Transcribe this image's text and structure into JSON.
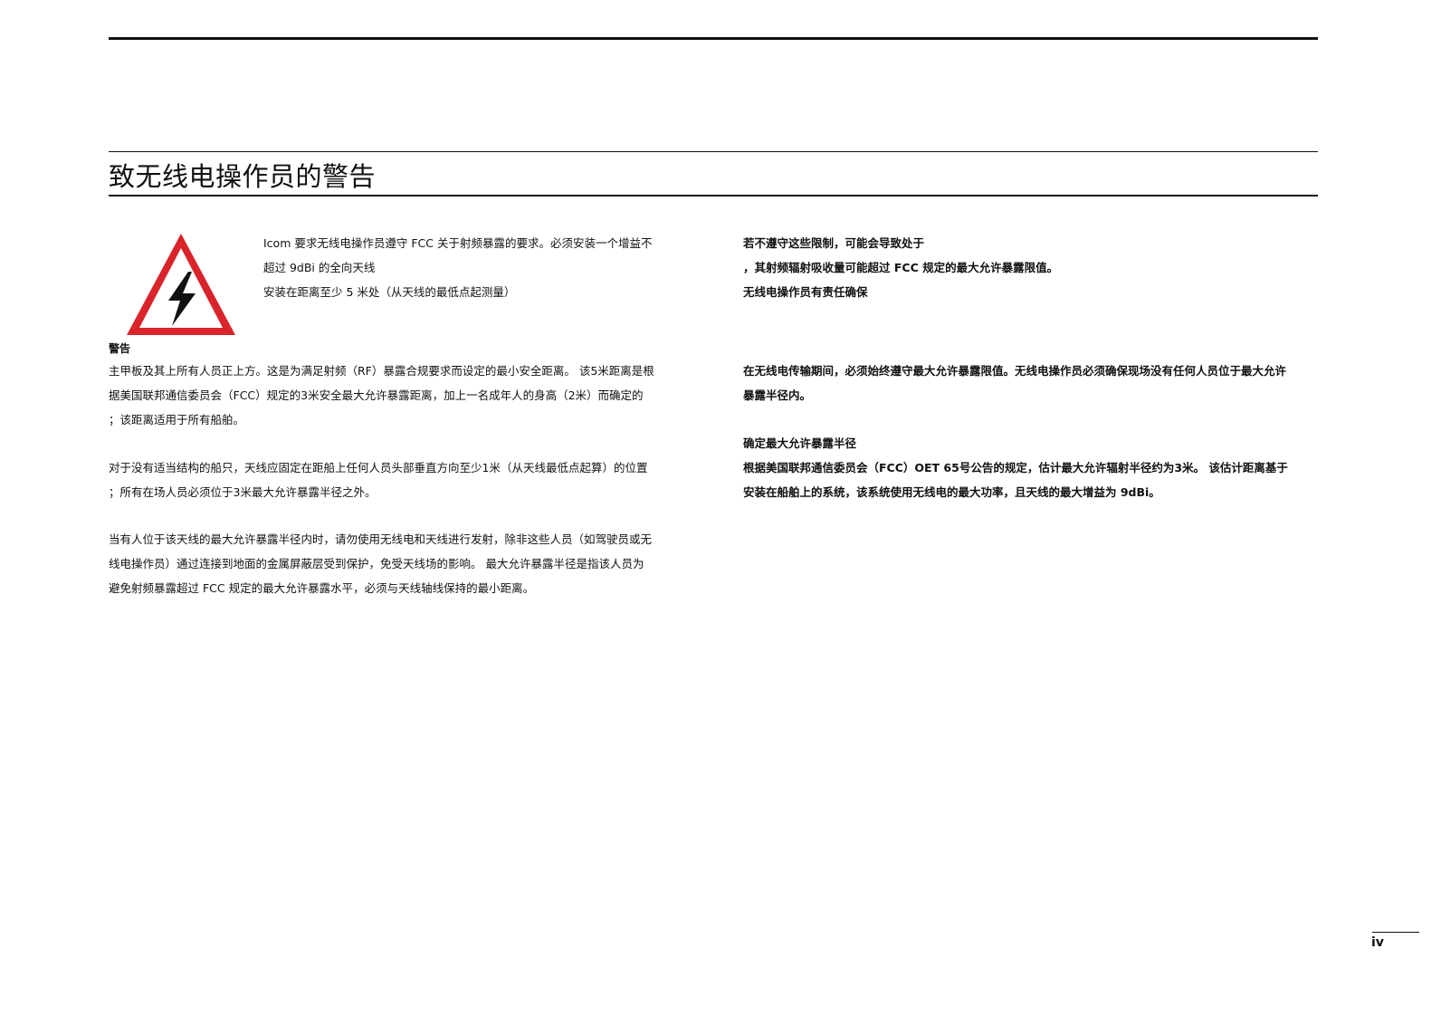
{
  "page": {
    "title": "致无线电操作员的警告",
    "page_number": "iv"
  },
  "left": {
    "intro_lines": [
      "Icom 要求无线电操作员遵守 FCC 关于射频暴露的要求。必须安装一个增益不",
      "超过 9dBi 的全向天线",
      "安装在距离至少 5 米处（从天线的最低点起测量）"
    ],
    "warning_label": "警告",
    "para1_lines": [
      "主甲板及其上所有人员正上方。这是为满足射频（RF）暴露合规要求而设定的最小安全距离。 该5米距离是根",
      "据美国联邦通信委员会（FCC）规定的3米安全最大允许暴露距离，加上一名成年人的身高（2米）而确定的",
      "；该距离适用于所有船舶。"
    ],
    "para2_lines": [
      "对于没有适当结构的船只，天线应固定在距船上任何人员头部垂直方向至少1米（从天线最低点起算）的位置",
      "；所有在场人员必须位于3米最大允许暴露半径之外。"
    ],
    "para3_lines": [
      "当有人位于该天线的最大允许暴露半径内时，请勿使用无线电和天线进行发射，除非这些人员（如驾驶员或无",
      "线电操作员）通过连接到地面的金属屏蔽层受到保护，免受天线场的影响。 最大允许暴露半径是指该人员为",
      "避免射频暴露超过 FCC 规定的最大允许暴露水平，必须与天线轴线保持的最小距离。"
    ]
  },
  "right": {
    "block1_lines": [
      "若不遵守这些限制，可能会导致处于",
      "，其射频辐射吸收量可能超过 FCC 规定的最大允许暴露限值。",
      "无线电操作员有责任确保"
    ],
    "block2_lines": [
      "在无线电传输期间，必须始终遵守最大允许暴露限值。无线电操作员必须确保现场没有任何人员位于最大允许",
      "暴露半径内。"
    ],
    "block3_heading": "确定最大允许暴露半径",
    "block3_lines": [
      "根据美国联邦通信委员会（FCC）OET 65号公告的规定，估计最大允许辐射半径约为3米。 该估计距离基于",
      "安装在船舶上的系统，该系统使用无线电的最大功率，且天线的最大增益为 9dBi。"
    ]
  },
  "icons": {
    "warning": "high-voltage-warning-icon"
  },
  "colors": {
    "sign_red": "#d8242a",
    "sign_black": "#111111",
    "text": "#111111"
  }
}
